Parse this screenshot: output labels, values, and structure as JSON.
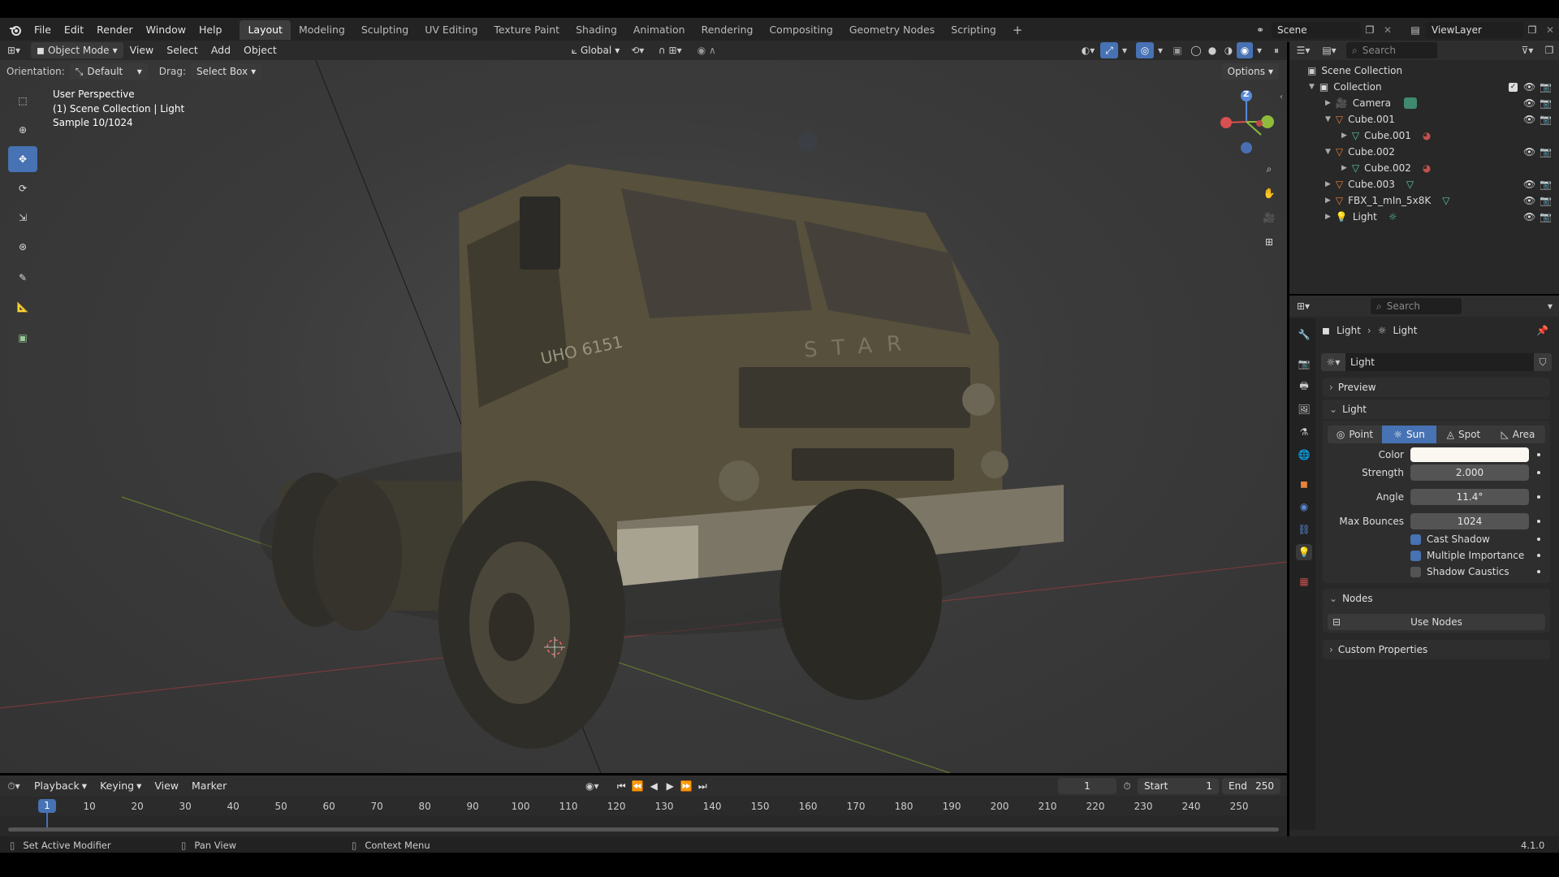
{
  "menu": {
    "file": "File",
    "edit": "Edit",
    "render": "Render",
    "window": "Window",
    "help": "Help"
  },
  "workspaces": [
    {
      "label": "Layout",
      "active": true
    },
    {
      "label": "Modeling"
    },
    {
      "label": "Sculpting"
    },
    {
      "label": "UV Editing"
    },
    {
      "label": "Texture Paint"
    },
    {
      "label": "Shading"
    },
    {
      "label": "Animation"
    },
    {
      "label": "Rendering"
    },
    {
      "label": "Compositing"
    },
    {
      "label": "Geometry Nodes"
    },
    {
      "label": "Scripting"
    }
  ],
  "add_workspace": "+",
  "scene": {
    "name": "Scene",
    "view_layer": "ViewLayer"
  },
  "viewport_header": {
    "mode": "Object Mode",
    "view": "View",
    "select": "Select",
    "add": "Add",
    "object": "Object",
    "transform_orientation": "Global",
    "options": "Options"
  },
  "tool_settings": {
    "orientation_label": "Orientation:",
    "orientation_value": "Default",
    "drag_label": "Drag:",
    "drag_value": "Select Box"
  },
  "viewport_info": {
    "line1": "User Perspective",
    "line2": "(1) Scene Collection | Light",
    "line3": "Sample 10/1024"
  },
  "truck": {
    "plate": "UHO 6151",
    "brand": "STAR"
  },
  "gizmo": {
    "z": "Z"
  },
  "outliner": {
    "search_placeholder": "Search",
    "root": "Scene Collection",
    "collection": "Collection",
    "items": [
      {
        "name": "Camera",
        "type": "camera"
      },
      {
        "name": "Cube.001",
        "type": "mesh"
      },
      {
        "name": "Cube.001",
        "type": "mesh-data",
        "child": true
      },
      {
        "name": "Cube.002",
        "type": "mesh"
      },
      {
        "name": "Cube.002",
        "type": "mesh-data",
        "child": true
      },
      {
        "name": "Cube.003",
        "type": "mesh"
      },
      {
        "name": "FBX_1_mIn_5x8K",
        "type": "mesh"
      },
      {
        "name": "Light",
        "type": "light"
      }
    ]
  },
  "properties": {
    "search_placeholder": "Search",
    "breadcrumb": [
      "Light",
      "Light"
    ],
    "datablock": "Light",
    "sections": {
      "preview": "Preview",
      "light": "Light",
      "nodes": "Nodes",
      "custom": "Custom Properties"
    },
    "light_types": [
      "Point",
      "Sun",
      "Spot",
      "Area"
    ],
    "active_type": "Sun",
    "color_label": "Color",
    "color_value": "#fbf7f1",
    "strength_label": "Strength",
    "strength": "2.000",
    "angle_label": "Angle",
    "angle": "11.4°",
    "bounces_label": "Max Bounces",
    "bounces": "1024",
    "cast_shadow": "Cast Shadow",
    "multiple_importance": "Multiple Importance",
    "shadow_caustics": "Shadow Caustics",
    "use_nodes": "Use Nodes"
  },
  "timeline": {
    "playback": "Playback",
    "keying": "Keying",
    "view": "View",
    "marker": "Marker",
    "current_frame": "1",
    "start_label": "Start",
    "start": "1",
    "end_label": "End",
    "end": "250",
    "ticks": [
      "1",
      "10",
      "20",
      "30",
      "40",
      "50",
      "60",
      "70",
      "80",
      "90",
      "100",
      "110",
      "120",
      "130",
      "140",
      "150",
      "160",
      "170",
      "180",
      "190",
      "200",
      "210",
      "220",
      "230",
      "240",
      "250"
    ]
  },
  "status": {
    "left": "Set Active Modifier",
    "middle": "Pan View",
    "right": "Context Menu",
    "version": "4.1.0"
  },
  "colors": {
    "accent": "#4772b3",
    "header": "#303030",
    "panel": "#2a2a2a"
  }
}
